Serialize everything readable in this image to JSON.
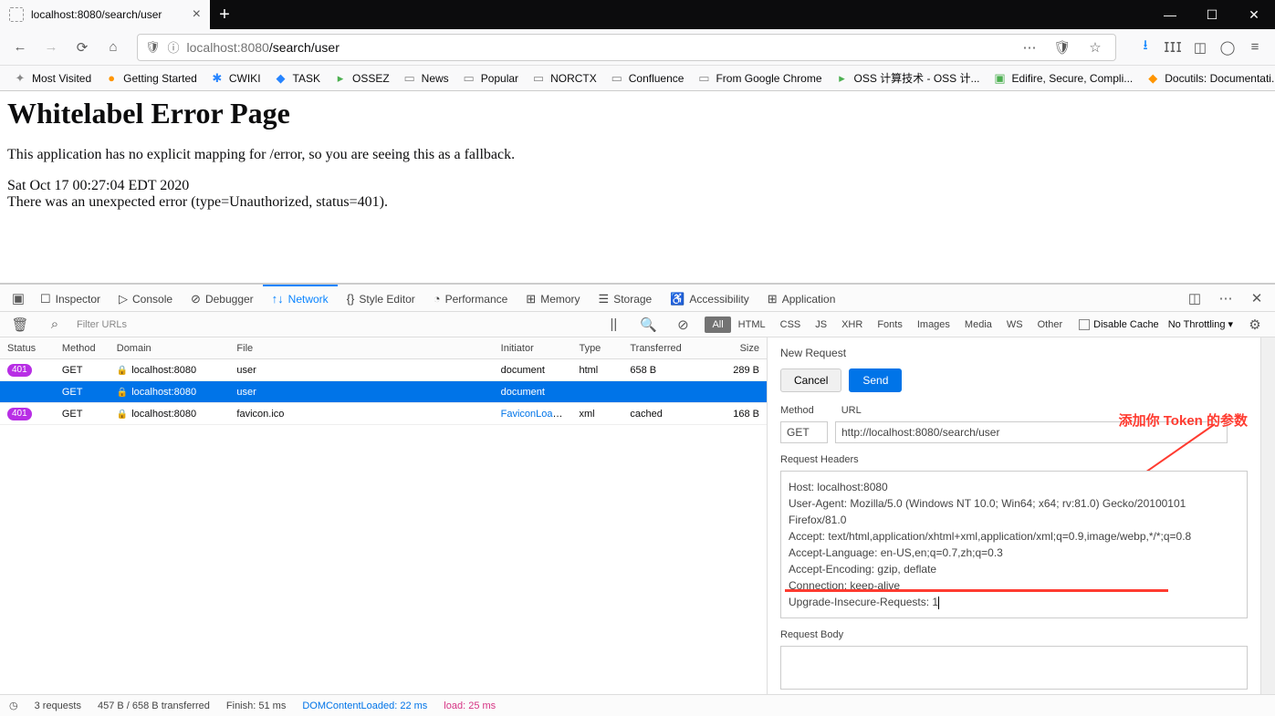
{
  "browser": {
    "tab_title": "localhost:8080/search/user",
    "url_display_host": "localhost",
    "url_display_port": ":8080",
    "url_display_path": "/search/user"
  },
  "bookmarks": [
    {
      "label": "Most Visited",
      "icon": "✦",
      "color": "#888"
    },
    {
      "label": "Getting Started",
      "icon": "●",
      "color": "#ff9500"
    },
    {
      "label": "CWIKI",
      "icon": "✱",
      "color": "#2684ff"
    },
    {
      "label": "TASK",
      "icon": "◆",
      "color": "#2684ff"
    },
    {
      "label": "OSSEZ",
      "icon": "▸",
      "color": "#4caf50"
    },
    {
      "label": "News",
      "icon": "▭",
      "color": "#888"
    },
    {
      "label": "Popular",
      "icon": "▭",
      "color": "#888"
    },
    {
      "label": "NORCTX",
      "icon": "▭",
      "color": "#888"
    },
    {
      "label": "Confluence",
      "icon": "▭",
      "color": "#888"
    },
    {
      "label": "From Google Chrome",
      "icon": "▭",
      "color": "#888"
    },
    {
      "label": "OSS 计算技术 - OSS 计...",
      "icon": "▸",
      "color": "#4caf50"
    },
    {
      "label": "Edifire, Secure, Compli...",
      "icon": "▣",
      "color": "#4caf50"
    },
    {
      "label": "Docutils: Documentati...",
      "icon": "◆",
      "color": "#ff9500"
    }
  ],
  "page": {
    "h1": "Whitelabel Error Page",
    "p1": "This application has no explicit mapping for /error, so you are seeing this as a fallback.",
    "ts": "Sat Oct 17 00:27:04 EDT 2020",
    "err": "There was an unexpected error (type=Unauthorized, status=401)."
  },
  "devtabs": {
    "inspector": "Inspector",
    "console": "Console",
    "debugger": "Debugger",
    "network": "Network",
    "style": "Style Editor",
    "perf": "Performance",
    "memory": "Memory",
    "storage": "Storage",
    "access": "Accessibility",
    "app": "Application"
  },
  "nettoolbar": {
    "filter_placeholder": "Filter URLs",
    "filters": [
      "All",
      "HTML",
      "CSS",
      "JS",
      "XHR",
      "Fonts",
      "Images",
      "Media",
      "WS",
      "Other"
    ],
    "disable_cache": "Disable Cache",
    "throttling": "No Throttling"
  },
  "netcols": {
    "status": "Status",
    "method": "Method",
    "domain": "Domain",
    "file": "File",
    "initiator": "Initiator",
    "type": "Type",
    "transferred": "Transferred",
    "size": "Size"
  },
  "netrows": [
    {
      "status": "401",
      "method": "GET",
      "domain": "localhost:8080",
      "file": "user",
      "initiator": "document",
      "type": "html",
      "transferred": "658 B",
      "size": "289 B",
      "badge": true,
      "selected": false
    },
    {
      "status": "",
      "method": "GET",
      "domain": "localhost:8080",
      "file": "user",
      "initiator": "document",
      "type": "",
      "transferred": "",
      "size": "",
      "badge": false,
      "selected": true
    },
    {
      "status": "401",
      "method": "GET",
      "domain": "localhost:8080",
      "file": "favicon.ico",
      "initiator": "FaviconLoad...",
      "initiator_link": true,
      "type": "xml",
      "transferred": "cached",
      "size": "168 B",
      "badge": true,
      "selected": false
    }
  ],
  "panel": {
    "title": "New Request",
    "cancel": "Cancel",
    "send": "Send",
    "method_label": "Method",
    "url_label": "URL",
    "method_value": "GET",
    "url_value": "http://localhost:8080/search/user",
    "headers_label": "Request Headers",
    "headers": "Host: localhost:8080\nUser-Agent: Mozilla/5.0 (Windows NT 10.0; Win64; x64; rv:81.0) Gecko/20100101 Firefox/81.0\nAccept: text/html,application/xhtml+xml,application/xml;q=0.9,image/webp,*/*;q=0.8\nAccept-Language: en-US,en;q=0.7,zh;q=0.3\nAccept-Encoding: gzip, deflate\nConnection: keep-alive\nUpgrade-Insecure-Requests: 1",
    "body_label": "Request Body",
    "annotation": "添加你 Token 的参数"
  },
  "status": {
    "requests": "3 requests",
    "transferred": "457 B / 658 B transferred",
    "finish": "Finish: 51 ms",
    "dcl": "DOMContentLoaded: 22 ms",
    "load": "load: 25 ms"
  }
}
